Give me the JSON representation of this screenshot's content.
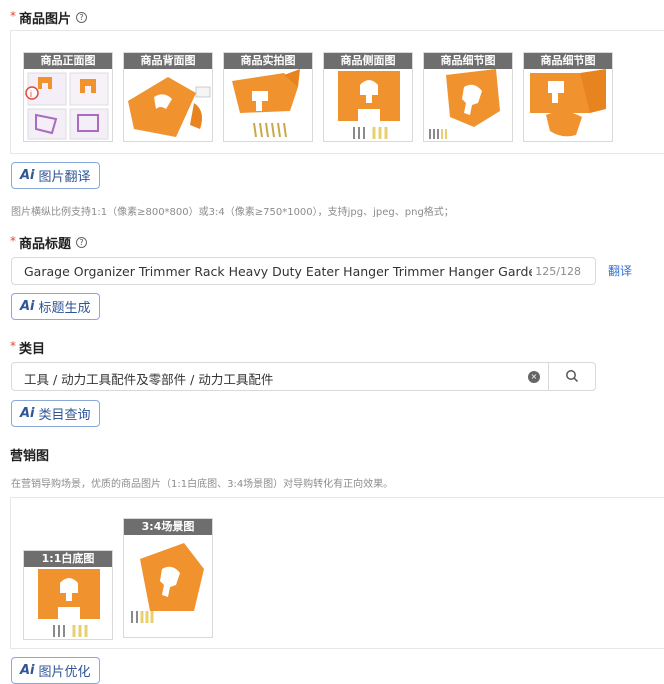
{
  "product_images": {
    "label": "商品图片",
    "help": "?",
    "thumbs": [
      "商品正面图",
      "商品背面图",
      "商品实拍图",
      "商品侧面图",
      "商品细节图",
      "商品细节图"
    ],
    "ai_button": "图片翻译",
    "hint": "图片横纵比例支持1:1（像素≥800*800）或3:4（像素≥750*1000），支持jpg、jpeg、png格式；"
  },
  "product_title": {
    "label": "商品标题",
    "help": "?",
    "value": "Garage Organizer Trimmer Rack Heavy Duty Eater Hanger Trimmer Hanger Garden Power Tool",
    "count": "125/128",
    "translate": "翻译",
    "ai_button": "标题生成"
  },
  "category": {
    "label": "类目",
    "value": "工具 / 动力工具配件及零部件 / 动力工具配件",
    "clear": "×",
    "ai_button": "类目查询"
  },
  "marketing": {
    "label": "营销图",
    "hint": "在营销导购场景，优质的商品图片（1:1白底图、3:4场景图）对导购转化有正向效果。",
    "thumbs": [
      "1:1白底图",
      "3:4场景图"
    ],
    "ai_button": "图片优化"
  },
  "ai_mark": "Ai",
  "colors": {
    "accent": "#2f5597",
    "product": "#f0922e",
    "required": "#e24a3b"
  }
}
